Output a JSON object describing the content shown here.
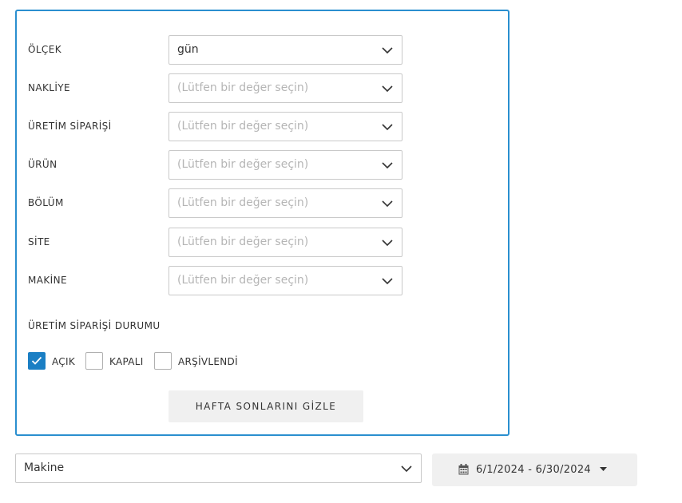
{
  "filters": {
    "rows": [
      {
        "label": "ÖLÇEK",
        "value": "gün",
        "placeholder": false
      },
      {
        "label": "NAKLİYE",
        "value": "(Lütfen bir değer seçin)",
        "placeholder": true
      },
      {
        "label": "ÜRETİM SİPARİŞİ",
        "value": "(Lütfen bir değer seçin)",
        "placeholder": true
      },
      {
        "label": "ÜRÜN",
        "value": "(Lütfen bir değer seçin)",
        "placeholder": true
      },
      {
        "label": "BÖLÜM",
        "value": "(Lütfen bir değer seçin)",
        "placeholder": true
      },
      {
        "label": "SİTE",
        "value": "(Lütfen bir değer seçin)",
        "placeholder": true
      },
      {
        "label": "MAKİNE",
        "value": "(Lütfen bir değer seçin)",
        "placeholder": true
      }
    ],
    "status_title": "ÜRETİM SİPARİŞİ DURUMU",
    "status_options": [
      {
        "label": "AÇIK",
        "checked": true
      },
      {
        "label": "KAPALI",
        "checked": false
      },
      {
        "label": "ARŞİVLENDİ",
        "checked": false
      }
    ],
    "hide_weekends_label": "HAFTA SONLARINI GİZLE"
  },
  "toolbar": {
    "group_by_value": "Makine",
    "date_range": "6/1/2024 - 6/30/2024"
  },
  "colors": {
    "accent": "#1b7fc4",
    "panel_border": "#2a8fcf"
  },
  "icons": [
    "chevron-down-icon",
    "check-icon",
    "calendar-icon",
    "caret-down-icon"
  ]
}
